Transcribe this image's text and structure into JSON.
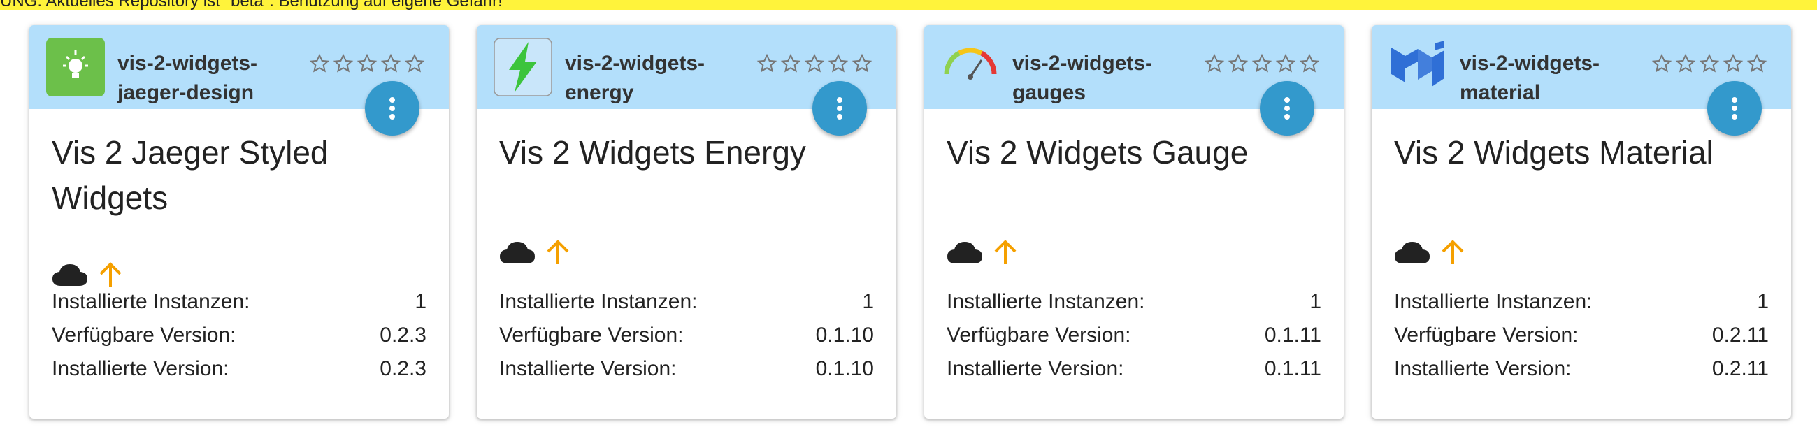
{
  "warning": "UNG: Aktuelles Repository ist \"beta\". Benutzung auf eigene Gefahr!",
  "labels": {
    "instances": "Installierte Instanzen:",
    "available": "Verfügbare Version:",
    "installed": "Installierte Version:"
  },
  "colors": {
    "header_bg": "#b3dffb",
    "menu_button": "#3399cc",
    "update_arrow": "#f5a000",
    "warning_bg": "#fff33b"
  },
  "cards": [
    {
      "name": "vis-2-widgets-jaeger-design",
      "title": "Vis 2 Jaeger Styled Widgets",
      "icon": "jaeger-design-icon",
      "rating": 0,
      "instances": "1",
      "available_version": "0.2.3",
      "installed_version": "0.2.3"
    },
    {
      "name": "vis-2-widgets-energy",
      "title": "Vis 2 Widgets Energy",
      "icon": "energy-lightning-icon",
      "rating": 0,
      "instances": "1",
      "available_version": "0.1.10",
      "installed_version": "0.1.10"
    },
    {
      "name": "vis-2-widgets-gauges",
      "title": "Vis 2 Widgets Gauge",
      "icon": "gauge-icon",
      "rating": 0,
      "instances": "1",
      "available_version": "0.1.11",
      "installed_version": "0.1.11"
    },
    {
      "name": "vis-2-widgets-material",
      "title": "Vis 2 Widgets Material",
      "icon": "material-logo-icon",
      "rating": 0,
      "instances": "1",
      "available_version": "0.2.11",
      "installed_version": "0.2.11"
    }
  ]
}
